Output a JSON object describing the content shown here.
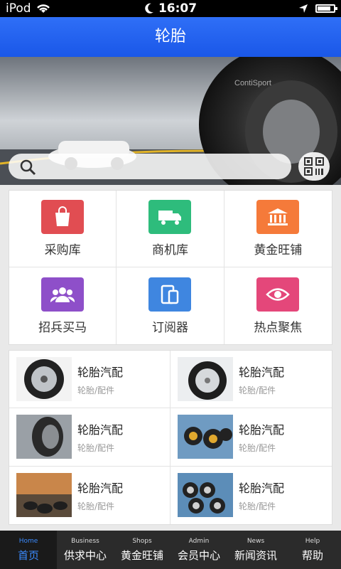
{
  "status": {
    "carrier": "iPod",
    "time": "16:07",
    "battery_level": 0.85
  },
  "title": "轮胎",
  "banner": {
    "brand_text": "ContiSport"
  },
  "menu": [
    {
      "label": "采购库",
      "color": "#e14d52",
      "icon": "shopping-bag-icon"
    },
    {
      "label": "商机库",
      "color": "#2ebc7c",
      "icon": "truck-icon"
    },
    {
      "label": "黄金旺铺",
      "color": "#f57a3a",
      "icon": "bank-icon"
    },
    {
      "label": "招兵买马",
      "color": "#8e4fc9",
      "icon": "people-icon"
    },
    {
      "label": "订阅器",
      "color": "#3f86e0",
      "icon": "devices-icon"
    },
    {
      "label": "热点聚焦",
      "color": "#e4477a",
      "icon": "eye-icon"
    }
  ],
  "products": [
    {
      "name": "轮胎汽配",
      "category": "轮胎/配件"
    },
    {
      "name": "轮胎汽配",
      "category": "轮胎/配件"
    },
    {
      "name": "轮胎汽配",
      "category": "轮胎/配件"
    },
    {
      "name": "轮胎汽配",
      "category": "轮胎/配件"
    },
    {
      "name": "轮胎汽配",
      "category": "轮胎/配件"
    },
    {
      "name": "轮胎汽配",
      "category": "轮胎/配件"
    }
  ],
  "tabs": [
    {
      "en": "Home",
      "cn": "首页",
      "active": true
    },
    {
      "en": "Business",
      "cn": "供求中心"
    },
    {
      "en": "Shops",
      "cn": "黄金旺铺"
    },
    {
      "en": "Admin",
      "cn": "会员中心"
    },
    {
      "en": "News",
      "cn": "新闻资讯"
    },
    {
      "en": "Help",
      "cn": "帮助"
    }
  ]
}
